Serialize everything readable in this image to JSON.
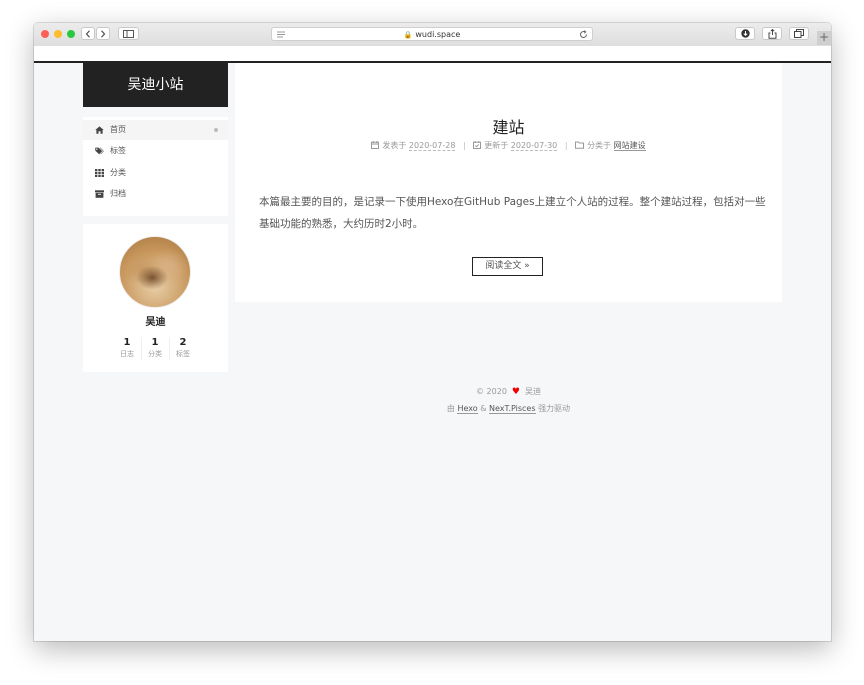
{
  "browser": {
    "url": "wudi.space"
  },
  "site": {
    "brand": "吴迪小站"
  },
  "menu": {
    "items": [
      {
        "label": "首页",
        "icon": "home-icon"
      },
      {
        "label": "标签",
        "icon": "tags-icon"
      },
      {
        "label": "分类",
        "icon": "th-icon"
      },
      {
        "label": "归档",
        "icon": "archive-icon"
      }
    ]
  },
  "profile": {
    "author": "吴迪",
    "stats": [
      {
        "count": "1",
        "label": "日志"
      },
      {
        "count": "1",
        "label": "分类"
      },
      {
        "count": "2",
        "label": "标签"
      }
    ]
  },
  "post": {
    "title": "建站",
    "posted_label": "发表于",
    "posted_date": "2020-07-28",
    "updated_label": "更新于",
    "updated_date": "2020-07-30",
    "category_label": "分类于",
    "category": "网站建设",
    "separator": "|",
    "excerpt": "本篇最主要的目的，是记录一下使用Hexo在GitHub Pages上建立个人站的过程。整个建站过程，包括对一些基础功能的熟悉，大约历时2小时。",
    "read_more": "阅读全文 »"
  },
  "footer": {
    "copyright": "© 2020",
    "heart": "♥",
    "author": "吴迪",
    "powered_prefix": "由",
    "hexo": "Hexo",
    "amp": "&",
    "theme": "NexT.Pisces",
    "powered_suffix": "强力驱动"
  },
  "colors": {
    "brand_bg": "#222222",
    "heart": "#ee0000",
    "page_bg": "#f5f7f9"
  }
}
